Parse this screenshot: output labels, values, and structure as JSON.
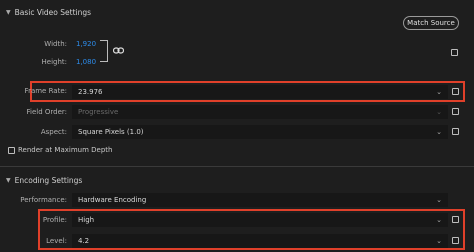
{
  "basic_video": {
    "header": "Basic Video Settings",
    "match_source_label": "Match Source",
    "width_label": "Width:",
    "width_value": "1,920",
    "height_label": "Height:",
    "height_value": "1,080",
    "frame_rate_label": "Frame Rate:",
    "frame_rate_value": "23.976",
    "field_order_label": "Field Order:",
    "field_order_value": "Progressive",
    "aspect_label": "Aspect:",
    "aspect_value": "Square Pixels (1.0)",
    "render_max_depth_label": "Render at Maximum Depth"
  },
  "encoding": {
    "header": "Encoding Settings",
    "performance_label": "Performance:",
    "performance_value": "Hardware Encoding",
    "profile_label": "Profile:",
    "profile_value": "High",
    "level_label": "Level:",
    "level_value": "4.2"
  },
  "colors": {
    "highlight": "#e0402a",
    "link": "#2d8ceb",
    "background": "#1e1e1e"
  },
  "icons": [
    "chevron-down-icon",
    "link-icon",
    "dropdown-caret-icon",
    "checkbox"
  ]
}
